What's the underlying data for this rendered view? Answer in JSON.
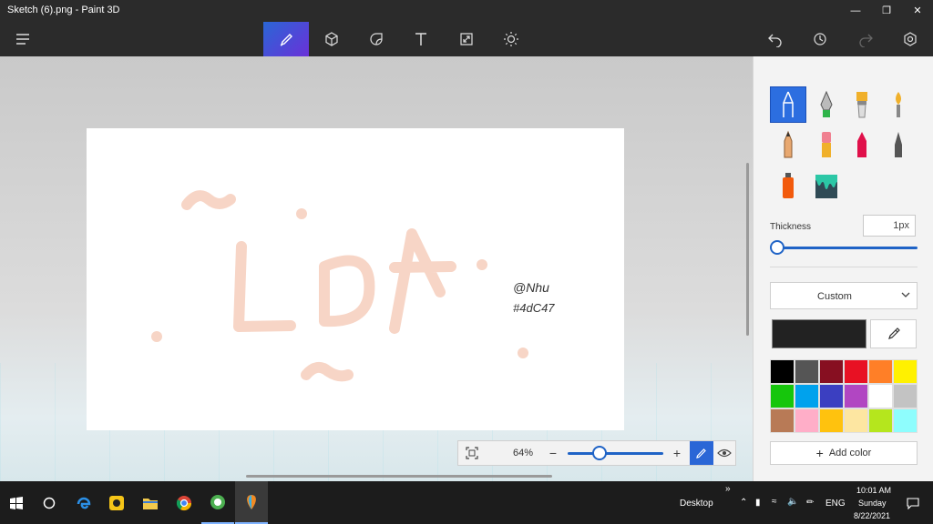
{
  "window": {
    "title": "Sketch (6).png - Paint 3D"
  },
  "toolbar": {
    "tools": [
      "brushes-tool",
      "3d-shapes-tool",
      "stickers-tool",
      "text-tool",
      "canvas-tool",
      "effects-tool"
    ]
  },
  "canvas": {
    "signature_line1": "@Nhu",
    "signature_line2": "#4dC47",
    "drawn_text": "LDA",
    "stroke_color": "#f7d5c6"
  },
  "zoom": {
    "level": "64%",
    "minus": "−",
    "plus": "+"
  },
  "panel": {
    "thickness_label": "Thickness",
    "thickness_value": "1px",
    "thickness_fraction": 0,
    "style_dropdown": "Custom",
    "current_color": "#222222",
    "palette": [
      "#000000",
      "#555555",
      "#870f21",
      "#e81123",
      "#ff7f27",
      "#fff100",
      "#16c60c",
      "#00a2ed",
      "#3b3fc1",
      "#b146c2",
      "#ffffff",
      "#c3c3c3",
      "#b87a56",
      "#ffaec8",
      "#ffc20e",
      "#fde6a1",
      "#b5e61d",
      "#8efdfd"
    ],
    "add_color_label": "Add color"
  },
  "taskbar": {
    "desktop_label": "Desktop",
    "lang": "ENG",
    "time": "10:01 AM",
    "day": "Sunday",
    "date": "8/22/2021",
    "chevron": "»"
  }
}
